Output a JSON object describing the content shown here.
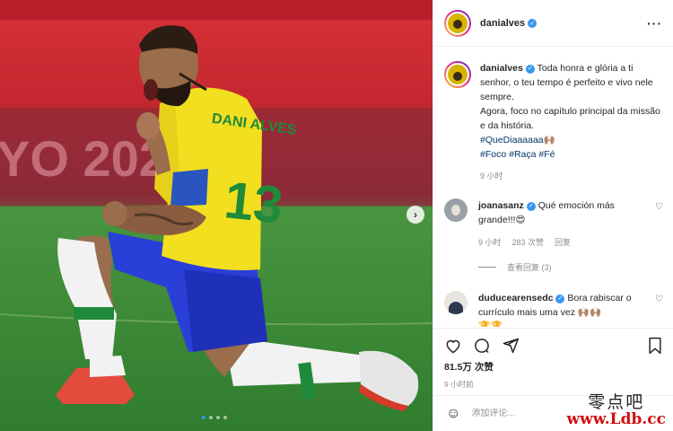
{
  "post": {
    "author": {
      "username": "danialves",
      "verified": true
    },
    "more_icon": "ellipsis-icon",
    "image": {
      "background_text": "YO 2020",
      "jersey_name": "DANI ALVES",
      "jersey_number": "13",
      "carousel": {
        "count": 4,
        "active": 0
      },
      "next_icon": "chevron-right-icon"
    },
    "caption": {
      "username": "danialves",
      "text": "Toda honra e glória a ti senhor, o teu tempo é perfeito e vivo nele sempre.",
      "text2": "Agora, foco no capítulo principal da missão e da história.",
      "hashtag1": "#QueDiaaaaaa🙌🏽",
      "hashtag2": "#Foco #Raça #Fé",
      "time": "9 小时"
    },
    "comments": [
      {
        "username": "joanasanz",
        "verified": true,
        "text": "Qué emoción más grande!!!😍",
        "time": "9 小时",
        "likes": "283 次赞",
        "reply": "回复",
        "view_replies": "查看回复 (3)"
      },
      {
        "username": "duducearensedc",
        "verified": true,
        "text": "Bora rabiscar o currículo mais uma vez 🙌🏽🙌🏽",
        "emoji_row": "🏆🏆"
      }
    ],
    "likes_count": "81.5万 次赞",
    "posted_time": "9 小时前",
    "add_comment_placeholder": "添加评论...",
    "icons": [
      "heart-icon",
      "comment-icon",
      "share-icon",
      "bookmark-icon",
      "emoji-icon"
    ]
  },
  "watermark": {
    "line1": "零点吧",
    "line2": "www.Ldb.cc"
  },
  "colors": {
    "accent": "#3897f0",
    "jersey_yellow": "#f2df1f",
    "shorts_blue": "#2a3fd8",
    "pitch_green": "#3e8b3a"
  }
}
